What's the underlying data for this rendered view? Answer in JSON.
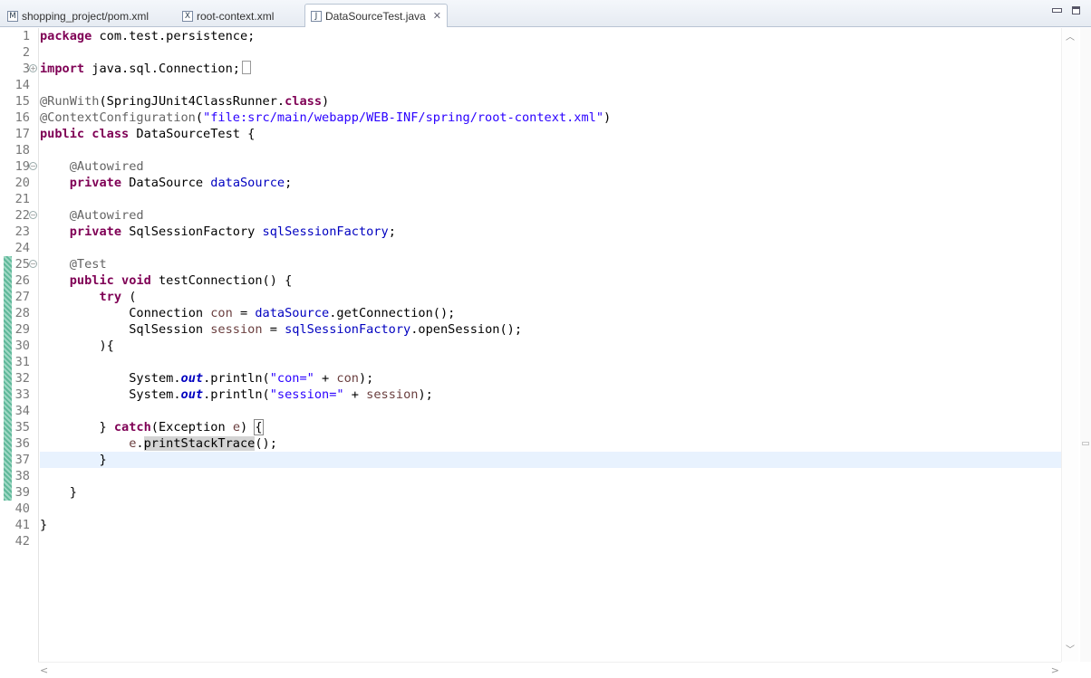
{
  "tabs": [
    {
      "label": "shopping_project/pom.xml",
      "icon": "maven-file-icon",
      "icon_glyph": "M"
    },
    {
      "label": "root-context.xml",
      "icon": "xml-file-icon",
      "icon_glyph": "X"
    },
    {
      "label": "DataSourceTest.java",
      "icon": "java-file-icon",
      "icon_glyph": "J",
      "active": true
    }
  ],
  "line_numbers": [
    "1",
    "2",
    "3",
    "14",
    "15",
    "16",
    "17",
    "18",
    "19",
    "20",
    "21",
    "22",
    "23",
    "24",
    "25",
    "26",
    "27",
    "28",
    "29",
    "30",
    "31",
    "32",
    "33",
    "34",
    "35",
    "36",
    "37",
    "38",
    "39",
    "40",
    "41",
    "42"
  ],
  "code": {
    "package_kw": "package",
    "package_name": " com.test.persistence;",
    "import_kw": "import",
    "import_name": " java.sql.Connection;",
    "runwith_ann": "@RunWith",
    "runwith_open": "(SpringJUnit4ClassRunner.",
    "class_kw": "class",
    "runwith_close": ")",
    "ctx_ann": "@ContextConfiguration",
    "ctx_open": "(",
    "ctx_str": "\"file:src/main/webapp/WEB-INF/spring/root-context.xml\"",
    "ctx_close": ")",
    "public_kw": "public",
    "class_kw2": "class",
    "class_name": " DataSourceTest {",
    "autowired": "@Autowired",
    "private_kw": "private",
    "ds_type": " DataSource ",
    "ds_field": "dataSource",
    "semi": ";",
    "ssf_type": " SqlSessionFactory ",
    "ssf_field": "sqlSessionFactory",
    "test_ann": "@Test",
    "void_kw": "void",
    "method_sig": " testConnection() {",
    "try_kw": "try",
    "try_open": " (",
    "conn_type": "Connection ",
    "conn_var": "con",
    "eq": " = ",
    "get_conn": ".getConnection();",
    "sess_type": "SqlSession ",
    "sess_var": "session",
    "open_sess": ".openSession();",
    "close_paren": "){",
    "sys": "System.",
    "out": "out",
    "println": ".println(",
    "str_con": "\"con=\"",
    "plus": " + ",
    "close_call": ");",
    "str_session": "\"session=\"",
    "brace_close": "} ",
    "catch_kw": "catch",
    "catch_sig": "(Exception ",
    "e_var": "e",
    "catch_end": ") ",
    "open_brace": "{",
    "print_trace": "printStackTrace",
    "call_end": "();",
    "rbrace": "}"
  },
  "colors": {
    "keyword": "#7f0055",
    "annotation": "#646464",
    "string": "#2a00ff",
    "field": "#0000c0",
    "local_var": "#6a3e3e",
    "current_line": "#e8f2fe"
  }
}
